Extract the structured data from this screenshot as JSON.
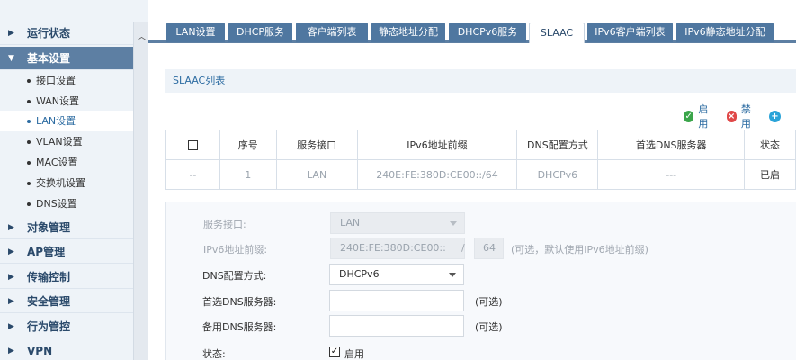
{
  "sidebar": {
    "categories": [
      {
        "label": "运行状态",
        "open": false
      },
      {
        "label": "基本设置",
        "open": true
      },
      {
        "label": "对象管理",
        "open": false
      },
      {
        "label": "AP管理",
        "open": false
      },
      {
        "label": "传输控制",
        "open": false
      },
      {
        "label": "安全管理",
        "open": false
      },
      {
        "label": "行为管控",
        "open": false
      },
      {
        "label": "VPN",
        "open": false
      }
    ],
    "subitems": [
      {
        "label": "接口设置"
      },
      {
        "label": "WAN设置"
      },
      {
        "label": "LAN设置",
        "active": true
      },
      {
        "label": "VLAN设置"
      },
      {
        "label": "MAC设置"
      },
      {
        "label": "交换机设置"
      },
      {
        "label": "DNS设置"
      }
    ]
  },
  "tabs": [
    {
      "label": "LAN设置"
    },
    {
      "label": "DHCP服务"
    },
    {
      "label": "客户端列表"
    },
    {
      "label": "静态地址分配"
    },
    {
      "label": "DHCPv6服务"
    },
    {
      "label": "SLAAC",
      "active": true
    },
    {
      "label": "IPv6客户端列表"
    },
    {
      "label": "IPv6静态地址分配"
    }
  ],
  "section": {
    "title": "SLAAC列表"
  },
  "actions": {
    "enable": "启用",
    "disable": "禁用"
  },
  "table": {
    "headers": [
      "序号",
      "服务接口",
      "IPv6地址前缀",
      "DNS配置方式",
      "首选DNS服务器",
      "状态"
    ],
    "rows": [
      {
        "check": "--",
        "index": "1",
        "iface": "LAN",
        "prefix": "240E:FE:380D:CE00::/64",
        "dns_mode": "DHCPv6",
        "dns_primary": "---",
        "status": "已启"
      }
    ]
  },
  "form": {
    "iface": {
      "label": "服务接口:",
      "value": "LAN"
    },
    "prefix": {
      "label": "IPv6地址前缀:",
      "value": "240E:FE:380D:CE00::",
      "sep": "/",
      "len": "64",
      "hint": "(可选，默认使用IPv6地址前缀)"
    },
    "dns_mode": {
      "label": "DNS配置方式:",
      "value": "DHCPv6"
    },
    "dns_primary": {
      "label": "首选DNS服务器:",
      "value": "",
      "hint": "(可选)"
    },
    "dns_backup": {
      "label": "备用DNS服务器:",
      "value": "",
      "hint": "(可选)"
    },
    "status": {
      "label": "状态:",
      "check_label": "启用",
      "checked": true
    }
  },
  "colors": {
    "accent": "#4f77a0",
    "sidebar_active": "#5d7fa3",
    "enable_icon": "#3aa54a",
    "disable_icon": "#e04848",
    "add_icon": "#2aa3d8"
  }
}
